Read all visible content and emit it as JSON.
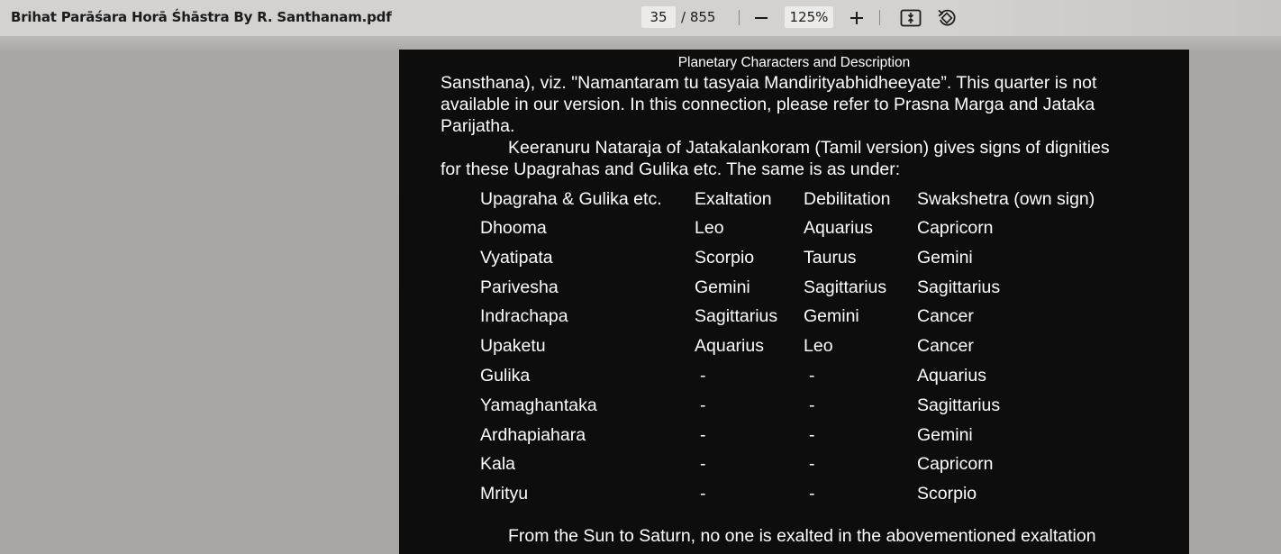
{
  "toolbar": {
    "document_title": "Brihat Parāśara Horā Śhāstra By R. Santhanam.pdf",
    "current_page": "35",
    "page_total": "/ 855",
    "zoom_out_icon": "minus-icon",
    "zoom_level": "125%",
    "zoom_in_icon": "plus-icon",
    "fit_page_icon": "fit-to-page-icon",
    "rotate_icon": "rotate-icon"
  },
  "page": {
    "running_head": "Planetary Characters and Description",
    "paragraph1_lines": [
      "Sansthana), viz. \"Namantaram tu tasyaia Mandirityabhidheeyate”. This quarter is not",
      "available in our version. In this connection, please refer to Prasna Marga and Jataka",
      "Parijatha."
    ],
    "paragraph2_lines": [
      "Keeranuru Nataraja of Jatakalankoram (Tamil version) gives signs of dignities",
      "for these Upagrahas and Gulika etc. The same is as under:"
    ],
    "table": {
      "headers": [
        "Upagraha & Gulika etc.",
        "Exaltation",
        "Debilitation",
        "Swakshetra (own sign)"
      ],
      "rows": [
        [
          "Dhooma",
          "Leo",
          "Aquarius",
          "Capricorn"
        ],
        [
          "Vyatipata",
          "Scorpio",
          "Taurus",
          "Gemini"
        ],
        [
          "Parivesha",
          "Gemini",
          "Sagittarius",
          "Sagittarius"
        ],
        [
          "Indrachapa",
          "Sagittarius",
          "Gemini",
          "Cancer"
        ],
        [
          "Upaketu",
          "Aquarius",
          "Leo",
          "Cancer"
        ],
        [
          "Gulika",
          "-",
          "-",
          "Aquarius"
        ],
        [
          "Yamaghantaka",
          "-",
          "-",
          "Sagittarius"
        ],
        [
          "Ardhapiahara",
          "-",
          "-",
          "Gemini"
        ],
        [
          "Kala",
          "-",
          "-",
          "Capricorn"
        ],
        [
          "Mrityu",
          "-",
          "-",
          "Scorpio"
        ]
      ]
    },
    "paragraph3_lines": [
      "From the Sun to Saturn, no one is exalted in the abovementioned exaltation"
    ]
  }
}
